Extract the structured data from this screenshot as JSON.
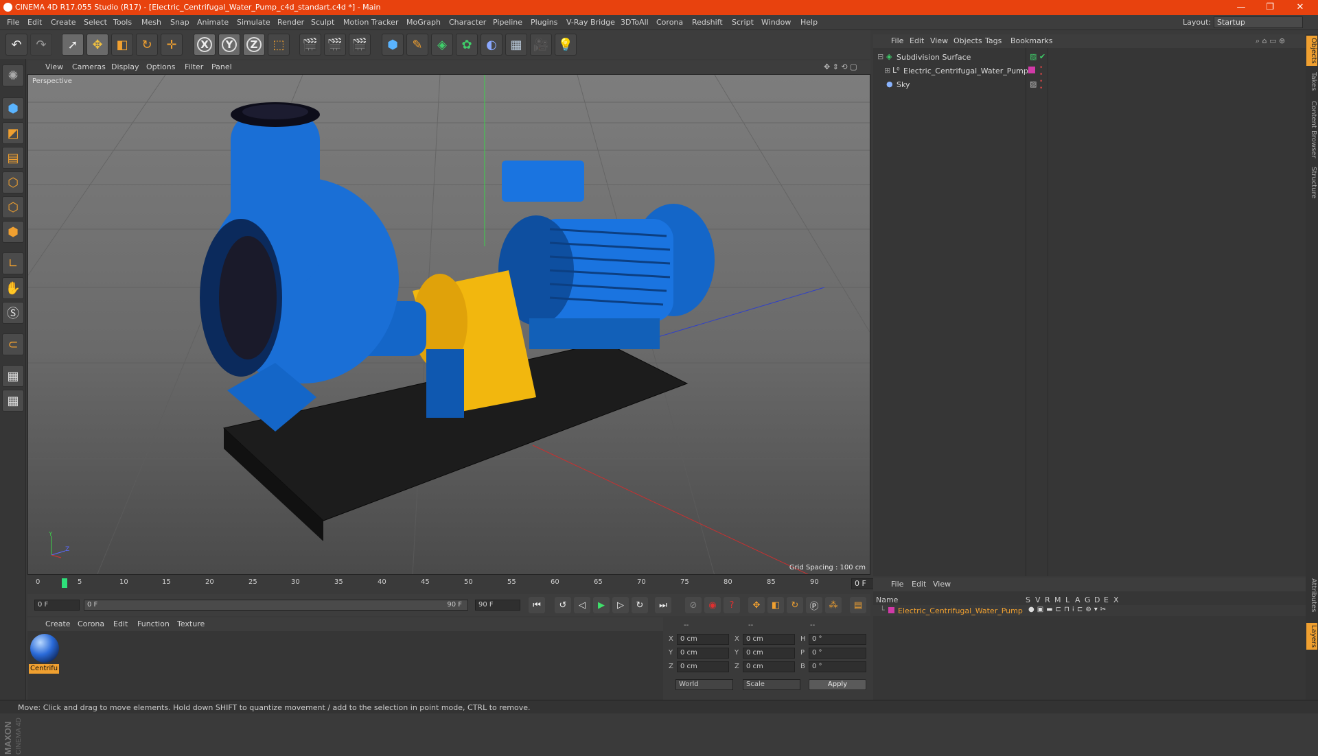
{
  "titlebar": {
    "title": "CINEMA 4D R17.055 Studio (R17) - [Electric_Centrifugal_Water_Pump_c4d_standart.c4d *] - Main",
    "minimize": "—",
    "restore": "❐",
    "close": "✕"
  },
  "menu": {
    "items": [
      "File",
      "Edit",
      "Create",
      "Select",
      "Tools",
      "Mesh",
      "Snap",
      "Animate",
      "Simulate",
      "Render",
      "Sculpt",
      "Motion Tracker",
      "MoGraph",
      "Character",
      "Pipeline",
      "Plugins",
      "V-Ray Bridge",
      "3DToAll",
      "Corona",
      "Redshift",
      "Script",
      "Window",
      "Help"
    ],
    "layout_label": "Layout:",
    "layout_value": "Startup"
  },
  "viewport": {
    "menu": [
      "View",
      "Cameras",
      "Display",
      "Options",
      "Filter",
      "Panel"
    ],
    "label": "Perspective",
    "grid_spacing": "Grid Spacing : 100 cm"
  },
  "objects": {
    "menu": [
      "File",
      "Edit",
      "View",
      "Objects",
      "Tags",
      "Bookmarks"
    ],
    "items": [
      {
        "name": "Subdivision Surface",
        "icon": "subdivision-icon"
      },
      {
        "name": "Electric_Centrifugal_Water_Pump",
        "icon": "null-icon",
        "tag_color": "#d13aa8"
      },
      {
        "name": "Sky",
        "icon": "sky-icon"
      }
    ]
  },
  "timeline": {
    "ticks": [
      "0",
      "5",
      "10",
      "15",
      "20",
      "25",
      "30",
      "35",
      "40",
      "45",
      "50",
      "55",
      "60",
      "65",
      "70",
      "75",
      "80",
      "85",
      "90"
    ],
    "current_frame": "0 F"
  },
  "transport": {
    "start": "0 F",
    "range_start": "0 F",
    "range_end": "90 F",
    "end": "90 F"
  },
  "material": {
    "menu": [
      "Create",
      "Corona",
      "Edit",
      "Function",
      "Texture"
    ],
    "name": "Centrifu"
  },
  "attributes": {
    "header": [
      "--",
      "--",
      "--"
    ],
    "rows": [
      {
        "a": "X",
        "av": "0 cm",
        "b": "X",
        "bv": "0 cm",
        "c": "H",
        "cv": "0 °"
      },
      {
        "a": "Y",
        "av": "0 cm",
        "b": "Y",
        "bv": "0 cm",
        "c": "P",
        "cv": "0 °"
      },
      {
        "a": "Z",
        "av": "0 cm",
        "b": "Z",
        "bv": "0 cm",
        "c": "B",
        "cv": "0 °"
      }
    ],
    "coord_mode": "World",
    "size_mode": "Scale",
    "apply": "Apply"
  },
  "layers": {
    "menu": [
      "File",
      "Edit",
      "View"
    ],
    "name_header": "Name",
    "col_headers": [
      "S",
      "V",
      "R",
      "M",
      "L",
      "A",
      "G",
      "D",
      "E",
      "X"
    ],
    "item": "Electric_Centrifugal_Water_Pump",
    "item_color": "#f0a030"
  },
  "sidetabs": [
    "Objects",
    "Takes",
    "Content Browser",
    "Structure",
    "Attributes",
    "Layers"
  ],
  "branding": "MAXON CINEMA 4D",
  "status": "Move: Click and drag to move elements. Hold down SHIFT to quantize movement / add to the selection in point mode, CTRL to remove."
}
